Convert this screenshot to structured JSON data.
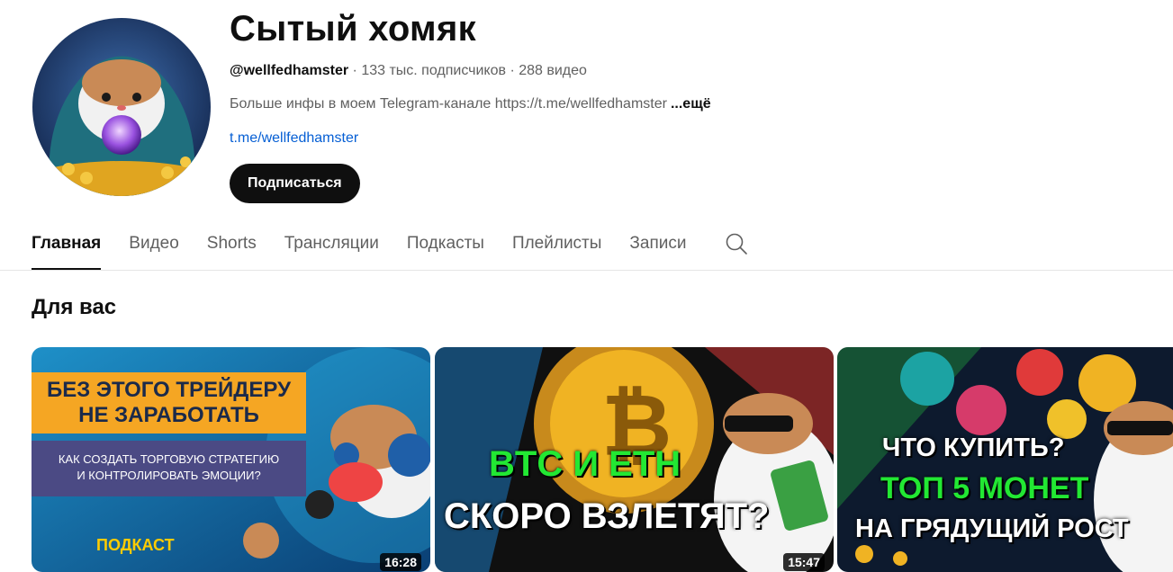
{
  "channel": {
    "title": "Сытый хомяк",
    "handle": "@wellfedhamster",
    "subscribers": "133 тыс. подписчиков",
    "video_count": "288 видео",
    "separator": " · ",
    "description": "Больше инфы в моем Telegram-канале https://t.me/wellfedhamster",
    "more_label": "...ещё",
    "link": "t.me/wellfedhamster",
    "subscribe_label": "Подписаться"
  },
  "tabs": [
    {
      "label": "Главная",
      "active": true
    },
    {
      "label": "Видео",
      "active": false
    },
    {
      "label": "Shorts",
      "active": false
    },
    {
      "label": "Трансляции",
      "active": false
    },
    {
      "label": "Подкасты",
      "active": false
    },
    {
      "label": "Плейлисты",
      "active": false
    },
    {
      "label": "Записи",
      "active": false
    }
  ],
  "search_icon": "search-icon",
  "section": {
    "title": "Для вас"
  },
  "videos": [
    {
      "thumb_line1": "БЕЗ ЭТОГО ТРЕЙДЕРУ",
      "thumb_line2": "НЕ ЗАРАБОТАТЬ",
      "thumb_sub1": "КАК СОЗДАТЬ ТОРГОВУЮ СТРАТЕГИЮ",
      "thumb_sub2": "И КОНТРОЛИРОВАТЬ ЭМОЦИИ?",
      "thumb_tag": "ПОДКАСТ",
      "duration": "16:28"
    },
    {
      "thumb_line1": "BTC И ETH",
      "thumb_line2": "СКОРО ВЗЛЕТЯТ?",
      "duration": "15:47"
    },
    {
      "thumb_line1": "ЧТО КУПИТЬ?",
      "thumb_line2": "ТОП 5 МОНЕТ",
      "thumb_line3": "НА ГРЯДУЩИЙ РОСТ"
    }
  ],
  "colors": {
    "accent": "#0f0f0f",
    "link": "#065fd4",
    "muted": "#606060"
  }
}
